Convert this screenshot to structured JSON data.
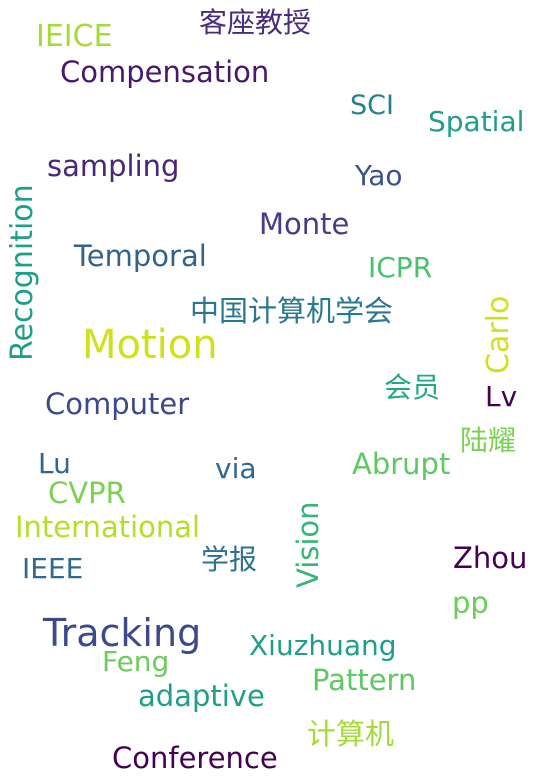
{
  "word_cloud": {
    "words": [
      {
        "text": "IEICE"
      },
      {
        "text": "客座教授"
      },
      {
        "text": "Compensation"
      },
      {
        "text": "SCI"
      },
      {
        "text": "Spatial"
      },
      {
        "text": "sampling"
      },
      {
        "text": "Yao"
      },
      {
        "text": "Monte"
      },
      {
        "text": "Temporal"
      },
      {
        "text": "ICPR"
      },
      {
        "text": "中国计算机学会"
      },
      {
        "text": "Motion"
      },
      {
        "text": "Computer"
      },
      {
        "text": "会员"
      },
      {
        "text": "Lv"
      },
      {
        "text": "陆耀"
      },
      {
        "text": "Lu"
      },
      {
        "text": "via"
      },
      {
        "text": "Abrupt"
      },
      {
        "text": "CVPR"
      },
      {
        "text": "International"
      },
      {
        "text": "IEEE"
      },
      {
        "text": "学报"
      },
      {
        "text": "Zhou"
      },
      {
        "text": "pp"
      },
      {
        "text": "Tracking"
      },
      {
        "text": "Xiuzhuang"
      },
      {
        "text": "Feng"
      },
      {
        "text": "Pattern"
      },
      {
        "text": "adaptive"
      },
      {
        "text": "计算机"
      },
      {
        "text": "Conference"
      },
      {
        "text": "Recognition"
      },
      {
        "text": "Carlo"
      },
      {
        "text": "Vision"
      }
    ]
  }
}
